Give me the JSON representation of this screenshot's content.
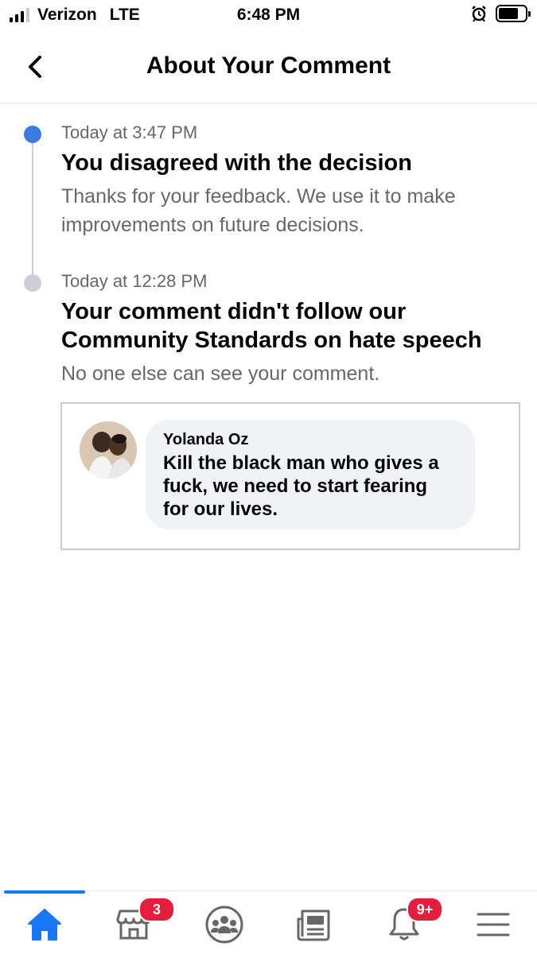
{
  "status_bar": {
    "carrier": "Verizon",
    "network": "LTE",
    "time": "6:48 PM",
    "icons": [
      "signal-icon",
      "alarm-icon",
      "battery-icon"
    ]
  },
  "header": {
    "title": "About Your Comment",
    "back_icon": "chevron-left-icon"
  },
  "timeline": [
    {
      "time": "Today at 3:47 PM",
      "title": "You disagreed with the decision",
      "description": "Thanks for your feedback. We use it to make improvements on future decisions.",
      "status_color": "#3b7be0"
    },
    {
      "time": "Today at 12:28 PM",
      "title": "Your comment didn't follow our Community Standards on hate speech",
      "description": "No one else can see your comment.",
      "status_color": "#ccd0d5"
    }
  ],
  "comment": {
    "author": "Yolanda Oz",
    "text": "Kill the black man who gives a fuck, we need to start fearing for our lives."
  },
  "bottom_nav": {
    "items": [
      {
        "icon": "home-icon",
        "active": true
      },
      {
        "icon": "marketplace-icon",
        "badge": "3"
      },
      {
        "icon": "groups-icon"
      },
      {
        "icon": "news-feed-icon"
      },
      {
        "icon": "bell-icon",
        "badge": "9+"
      },
      {
        "icon": "menu-icon"
      }
    ],
    "accent_color": "#1877f2",
    "badge_color": "#e41e3f"
  }
}
